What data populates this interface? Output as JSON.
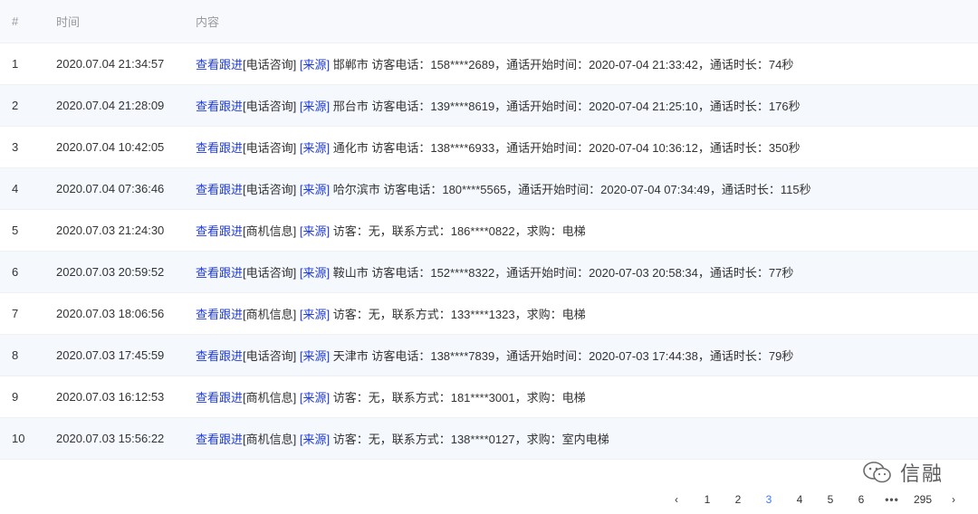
{
  "header": {
    "num": "#",
    "time": "时间",
    "content": "内容"
  },
  "rows": [
    {
      "num": "1",
      "time": "2020.07.04 21:34:57",
      "link": "查看跟进",
      "type": "[电话咨询]",
      "src": "[来源]",
      "text": " 邯郸市 访客电话：158****2689，通话开始时间：2020-07-04 21:33:42，通话时长：74秒"
    },
    {
      "num": "2",
      "time": "2020.07.04 21:28:09",
      "link": "查看跟进",
      "type": "[电话咨询]",
      "src": "[来源]",
      "text": " 邢台市 访客电话：139****8619，通话开始时间：2020-07-04 21:25:10，通话时长：176秒"
    },
    {
      "num": "3",
      "time": "2020.07.04 10:42:05",
      "link": "查看跟进",
      "type": "[电话咨询]",
      "src": "[来源]",
      "text": " 通化市 访客电话：138****6933，通话开始时间：2020-07-04 10:36:12，通话时长：350秒"
    },
    {
      "num": "4",
      "time": "2020.07.04 07:36:46",
      "link": "查看跟进",
      "type": "[电话咨询]",
      "src": "[来源]",
      "text": " 哈尔滨市 访客电话：180****5565，通话开始时间：2020-07-04 07:34:49，通话时长：115秒"
    },
    {
      "num": "5",
      "time": "2020.07.03 21:24:30",
      "link": "查看跟进",
      "type": "[商机信息]",
      "src": "[来源]",
      "text": " 访客：无，联系方式：186****0822，求购：电梯"
    },
    {
      "num": "6",
      "time": "2020.07.03 20:59:52",
      "link": "查看跟进",
      "type": "[电话咨询]",
      "src": "[来源]",
      "text": " 鞍山市 访客电话：152****8322，通话开始时间：2020-07-03 20:58:34，通话时长：77秒"
    },
    {
      "num": "7",
      "time": "2020.07.03 18:06:56",
      "link": "查看跟进",
      "type": "[商机信息]",
      "src": "[来源]",
      "text": " 访客：无，联系方式：133****1323，求购：电梯"
    },
    {
      "num": "8",
      "time": "2020.07.03 17:45:59",
      "link": "查看跟进",
      "type": "[电话咨询]",
      "src": "[来源]",
      "text": " 天津市 访客电话：138****7839，通话开始时间：2020-07-03 17:44:38，通话时长：79秒"
    },
    {
      "num": "9",
      "time": "2020.07.03 16:12:53",
      "link": "查看跟进",
      "type": "[商机信息]",
      "src": "[来源]",
      "text": " 访客：无，联系方式：181****3001，求购：电梯"
    },
    {
      "num": "10",
      "time": "2020.07.03 15:56:22",
      "link": "查看跟进",
      "type": "[商机信息]",
      "src": "[来源]",
      "text": " 访客：无，联系方式：138****0127，求购：室内电梯"
    }
  ],
  "watermark": {
    "text": "信融",
    "icon": "wechat-icon"
  },
  "pagination": {
    "prev": "‹",
    "pages": [
      "1",
      "2",
      "3",
      "4",
      "5",
      "6"
    ],
    "current": "3",
    "ellipsis": "•••",
    "last": "295",
    "next": "›"
  },
  "colors": {
    "link": "#1f3bd6",
    "active_page": "#3a7bf0",
    "row_alt": "#f5f8fd"
  }
}
